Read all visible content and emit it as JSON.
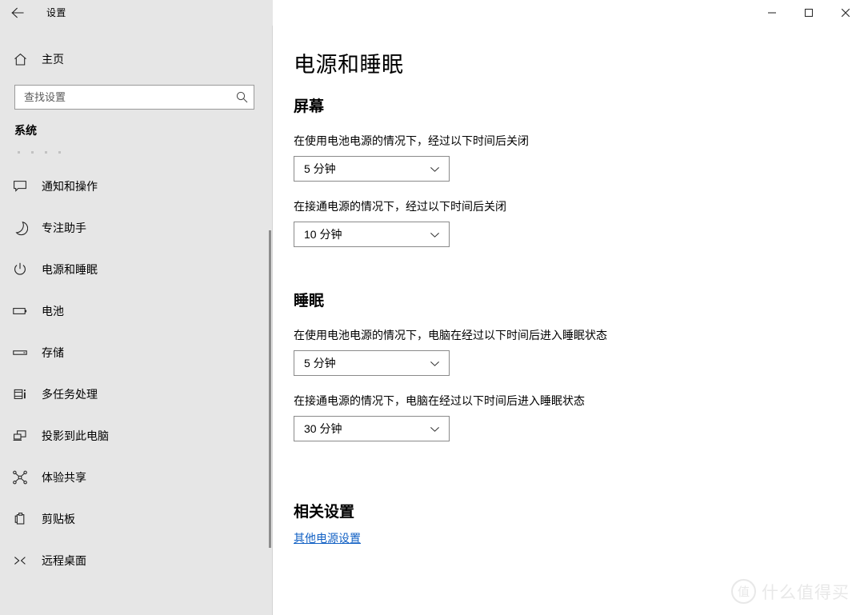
{
  "titlebar": {
    "back_icon": "back-arrow-icon",
    "title": "设置",
    "minimize_icon": "minimize-icon",
    "maximize_icon": "maximize-icon",
    "close_icon": "close-icon"
  },
  "sidebar": {
    "home": {
      "icon": "home-icon",
      "label": "主页"
    },
    "search": {
      "placeholder": "查找设置",
      "value": "",
      "icon": "search-icon"
    },
    "category": "系统",
    "items": [
      {
        "icon": "notifications-icon",
        "label": "通知和操作"
      },
      {
        "icon": "moon-icon",
        "label": "专注助手"
      },
      {
        "icon": "power-icon",
        "label": "电源和睡眠"
      },
      {
        "icon": "battery-icon",
        "label": "电池"
      },
      {
        "icon": "storage-icon",
        "label": "存储"
      },
      {
        "icon": "multitasking-icon",
        "label": "多任务处理"
      },
      {
        "icon": "projecting-icon",
        "label": "投影到此电脑"
      },
      {
        "icon": "shared-experiences-icon",
        "label": "体验共享"
      },
      {
        "icon": "clipboard-icon",
        "label": "剪贴板"
      },
      {
        "icon": "remote-desktop-icon",
        "label": "远程桌面"
      }
    ]
  },
  "main": {
    "page_title": "电源和睡眠",
    "screen_section": {
      "heading": "屏幕",
      "battery_label": "在使用电池电源的情况下，经过以下时间后关闭",
      "battery_value": "5 分钟",
      "plugged_label": "在接通电源的情况下，经过以下时间后关闭",
      "plugged_value": "10 分钟"
    },
    "sleep_section": {
      "heading": "睡眠",
      "battery_label": "在使用电池电源的情况下，电脑在经过以下时间后进入睡眠状态",
      "battery_value": "5 分钟",
      "plugged_label": "在接通电源的情况下，电脑在经过以下时间后进入睡眠状态",
      "plugged_value": "30 分钟"
    },
    "related_section": {
      "heading": "相关设置",
      "link": "其他电源设置"
    }
  },
  "watermark": {
    "logo_char": "值",
    "text": "什么值得买"
  },
  "colors": {
    "sidebar_bg": "#e6e6e6",
    "content_bg": "#ffffff",
    "link": "#1160c4",
    "border": "#8a8a8a",
    "watermark": "#e8e8e8"
  }
}
